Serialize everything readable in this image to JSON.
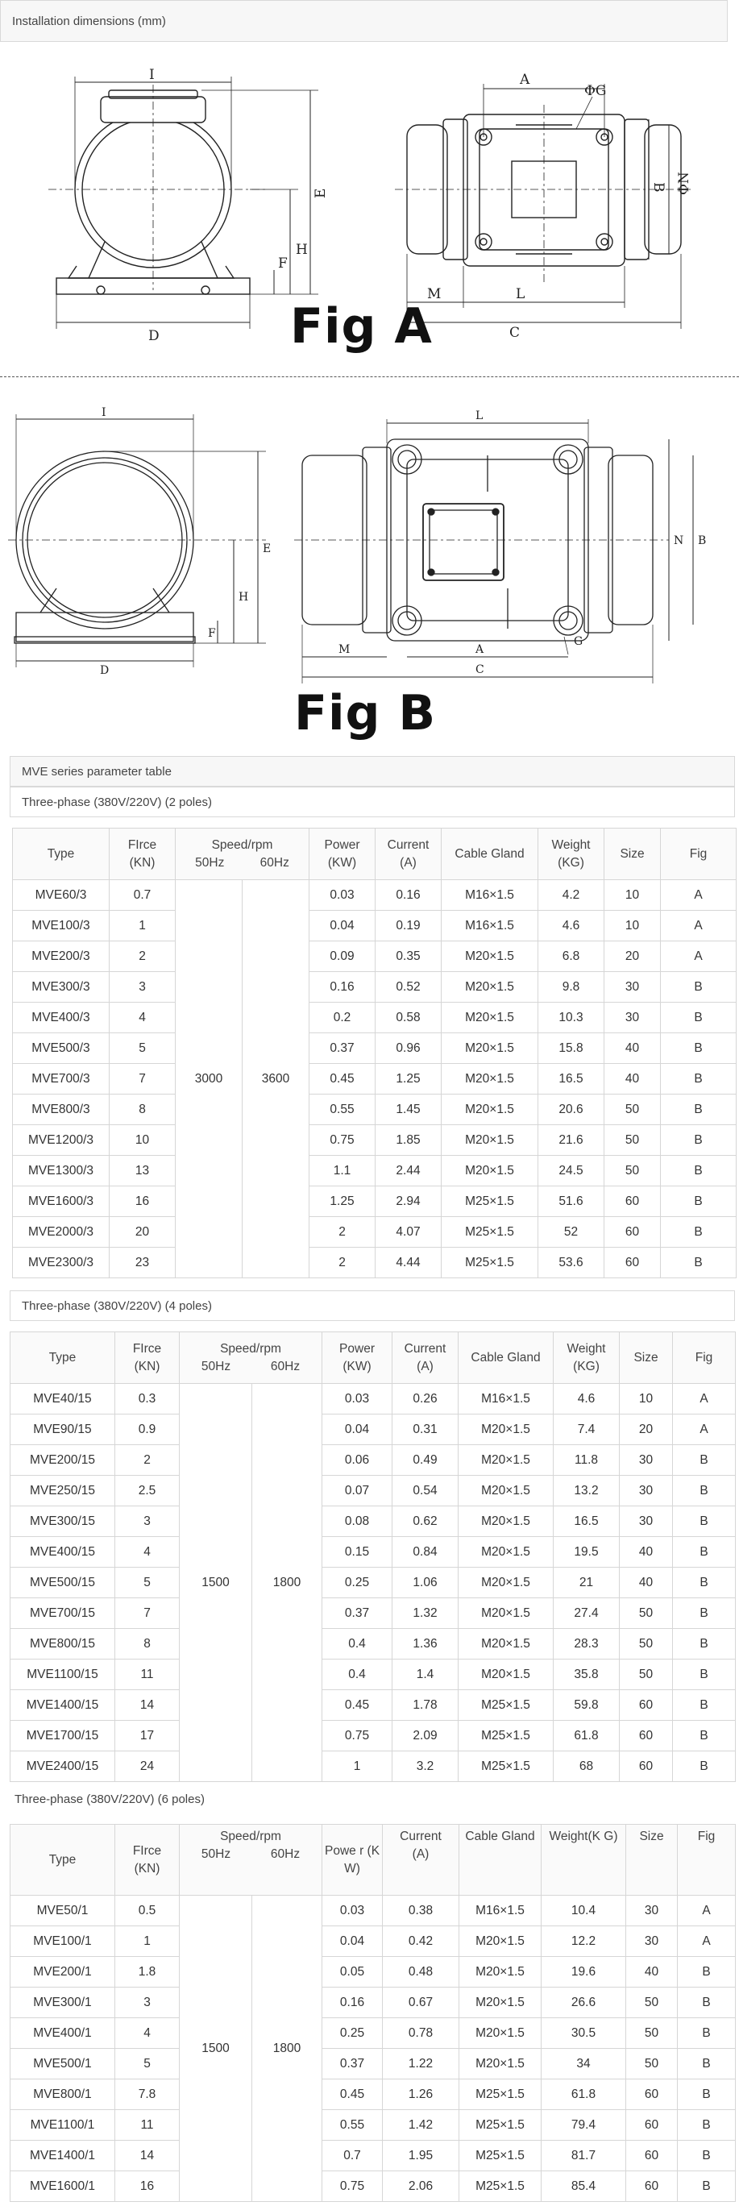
{
  "install_title": "Installation dimensions (mm)",
  "fig_a": {
    "label": "Fig A",
    "dims": {
      "I": "I",
      "E": "E",
      "H": "H",
      "F": "F",
      "D": "D",
      "A": "A",
      "G": "ΦG",
      "N": "ΦN",
      "B": "B",
      "M": "M",
      "L": "L",
      "C": "C"
    }
  },
  "fig_b": {
    "label": "Fig B",
    "dims": {
      "I": "I",
      "E": "E",
      "H": "H",
      "F": "F",
      "D": "D",
      "L": "L",
      "N": "N",
      "B": "B",
      "M": "M",
      "A": "A",
      "G": "G",
      "C": "C"
    }
  },
  "series_title": "MVE series parameter table",
  "headers": {
    "type": "Type",
    "force": "FIrce",
    "force_unit": "(KN)",
    "speed": "Speed/rpm",
    "hz50": "50Hz",
    "hz60": "60Hz",
    "power": "Power",
    "power_unit": "(KW)",
    "current": "Current",
    "current_unit": "(A)",
    "gland": "Cable Gland",
    "weight": "Weight",
    "weight_unit": "(KG)",
    "size": "Size",
    "fig": "Fig"
  },
  "headers_t3": {
    "power": "Powe r (KW)",
    "weight": "Weight(K G)",
    "gland": "Cable Gland"
  },
  "table1": {
    "title": "Three-phase (380V/220V) (2 poles)",
    "speed50": "3000",
    "speed60": "3600",
    "rows": [
      [
        "MVE60/3",
        "0.7",
        "0.03",
        "0.16",
        "M16×1.5",
        "4.2",
        "10",
        "A"
      ],
      [
        "MVE100/3",
        "1",
        "0.04",
        "0.19",
        "M16×1.5",
        "4.6",
        "10",
        "A"
      ],
      [
        "MVE200/3",
        "2",
        "0.09",
        "0.35",
        "M20×1.5",
        "6.8",
        "20",
        "A"
      ],
      [
        "MVE300/3",
        "3",
        "0.16",
        "0.52",
        "M20×1.5",
        "9.8",
        "30",
        "B"
      ],
      [
        "MVE400/3",
        "4",
        "0.2",
        "0.58",
        "M20×1.5",
        "10.3",
        "30",
        "B"
      ],
      [
        "MVE500/3",
        "5",
        "0.37",
        "0.96",
        "M20×1.5",
        "15.8",
        "40",
        "B"
      ],
      [
        "MVE700/3",
        "7",
        "0.45",
        "1.25",
        "M20×1.5",
        "16.5",
        "40",
        "B"
      ],
      [
        "MVE800/3",
        "8",
        "0.55",
        "1.45",
        "M20×1.5",
        "20.6",
        "50",
        "B"
      ],
      [
        "MVE1200/3",
        "10",
        "0.75",
        "1.85",
        "M20×1.5",
        "21.6",
        "50",
        "B"
      ],
      [
        "MVE1300/3",
        "13",
        "1.1",
        "2.44",
        "M20×1.5",
        "24.5",
        "50",
        "B"
      ],
      [
        "MVE1600/3",
        "16",
        "1.25",
        "2.94",
        "M25×1.5",
        "51.6",
        "60",
        "B"
      ],
      [
        "MVE2000/3",
        "20",
        "2",
        "4.07",
        "M25×1.5",
        "52",
        "60",
        "B"
      ],
      [
        "MVE2300/3",
        "23",
        "2",
        "4.44",
        "M25×1.5",
        "53.6",
        "60",
        "B"
      ]
    ]
  },
  "table2": {
    "title": "Three-phase (380V/220V) (4 poles)",
    "speed50": "1500",
    "speed60": "1800",
    "rows": [
      [
        "MVE40/15",
        "0.3",
        "0.03",
        "0.26",
        "M16×1.5",
        "4.6",
        "10",
        "A"
      ],
      [
        "MVE90/15",
        "0.9",
        "0.04",
        "0.31",
        "M20×1.5",
        "7.4",
        "20",
        "A"
      ],
      [
        "MVE200/15",
        "2",
        "0.06",
        "0.49",
        "M20×1.5",
        "11.8",
        "30",
        "B"
      ],
      [
        "MVE250/15",
        "2.5",
        "0.07",
        "0.54",
        "M20×1.5",
        "13.2",
        "30",
        "B"
      ],
      [
        "MVE300/15",
        "3",
        "0.08",
        "0.62",
        "M20×1.5",
        "16.5",
        "30",
        "B"
      ],
      [
        "MVE400/15",
        "4",
        "0.15",
        "0.84",
        "M20×1.5",
        "19.5",
        "40",
        "B"
      ],
      [
        "MVE500/15",
        "5",
        "0.25",
        "1.06",
        "M20×1.5",
        "21",
        "40",
        "B"
      ],
      [
        "MVE700/15",
        "7",
        "0.37",
        "1.32",
        "M20×1.5",
        "27.4",
        "50",
        "B"
      ],
      [
        "MVE800/15",
        "8",
        "0.4",
        "1.36",
        "M20×1.5",
        "28.3",
        "50",
        "B"
      ],
      [
        "MVE1100/15",
        "11",
        "0.4",
        "1.4",
        "M20×1.5",
        "35.8",
        "50",
        "B"
      ],
      [
        "MVE1400/15",
        "14",
        "0.45",
        "1.78",
        "M25×1.5",
        "59.8",
        "60",
        "B"
      ],
      [
        "MVE1700/15",
        "17",
        "0.75",
        "2.09",
        "M25×1.5",
        "61.8",
        "60",
        "B"
      ],
      [
        "MVE2400/15",
        "24",
        "1",
        "3.2",
        "M25×1.5",
        "68",
        "60",
        "B"
      ]
    ]
  },
  "table3": {
    "title": "Three-phase (380V/220V) (6 poles)",
    "speed50": "1500",
    "speed60": "1800",
    "rows": [
      [
        "MVE50/1",
        "0.5",
        "0.03",
        "0.38",
        "M16×1.5",
        "10.4",
        "30",
        "A"
      ],
      [
        "MVE100/1",
        "1",
        "0.04",
        "0.42",
        "M20×1.5",
        "12.2",
        "30",
        "A"
      ],
      [
        "MVE200/1",
        "1.8",
        "0.05",
        "0.48",
        "M20×1.5",
        "19.6",
        "40",
        "B"
      ],
      [
        "MVE300/1",
        "3",
        "0.16",
        "0.67",
        "M20×1.5",
        "26.6",
        "50",
        "B"
      ],
      [
        "MVE400/1",
        "4",
        "0.25",
        "0.78",
        "M20×1.5",
        "30.5",
        "50",
        "B"
      ],
      [
        "MVE500/1",
        "5",
        "0.37",
        "1.22",
        "M20×1.5",
        "34",
        "50",
        "B"
      ],
      [
        "MVE800/1",
        "7.8",
        "0.45",
        "1.26",
        "M25×1.5",
        "61.8",
        "60",
        "B"
      ],
      [
        "MVE1100/1",
        "11",
        "0.55",
        "1.42",
        "M25×1.5",
        "79.4",
        "60",
        "B"
      ],
      [
        "MVE1400/1",
        "14",
        "0.7",
        "1.95",
        "M25×1.5",
        "81.7",
        "60",
        "B"
      ],
      [
        "MVE1600/1",
        "16",
        "0.75",
        "2.06",
        "M25×1.5",
        "85.4",
        "60",
        "B"
      ]
    ]
  }
}
